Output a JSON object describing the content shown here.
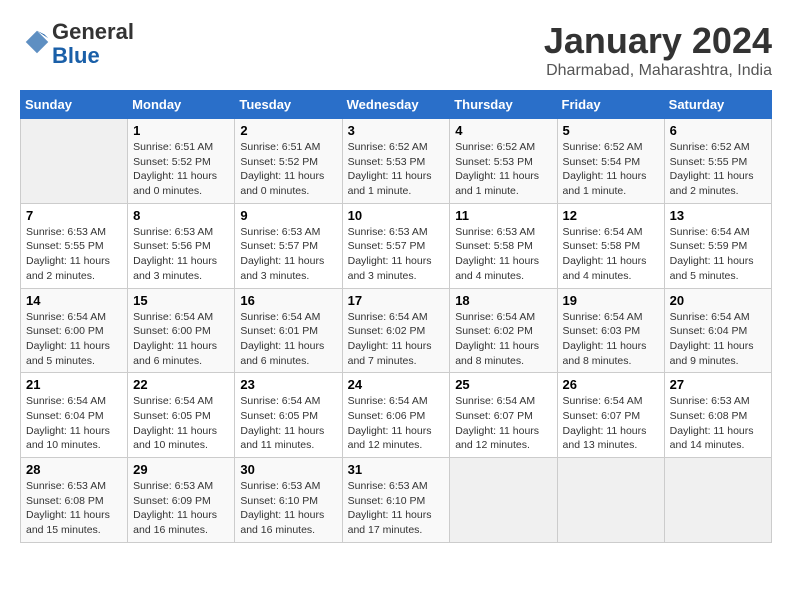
{
  "header": {
    "logo_line1": "General",
    "logo_line2": "Blue",
    "month": "January 2024",
    "location": "Dharmabad, Maharashtra, India"
  },
  "weekdays": [
    "Sunday",
    "Monday",
    "Tuesday",
    "Wednesday",
    "Thursday",
    "Friday",
    "Saturday"
  ],
  "weeks": [
    [
      {
        "day": "",
        "sunrise": "",
        "sunset": "",
        "daylight": ""
      },
      {
        "day": "1",
        "sunrise": "Sunrise: 6:51 AM",
        "sunset": "Sunset: 5:52 PM",
        "daylight": "Daylight: 11 hours and 0 minutes."
      },
      {
        "day": "2",
        "sunrise": "Sunrise: 6:51 AM",
        "sunset": "Sunset: 5:52 PM",
        "daylight": "Daylight: 11 hours and 0 minutes."
      },
      {
        "day": "3",
        "sunrise": "Sunrise: 6:52 AM",
        "sunset": "Sunset: 5:53 PM",
        "daylight": "Daylight: 11 hours and 1 minute."
      },
      {
        "day": "4",
        "sunrise": "Sunrise: 6:52 AM",
        "sunset": "Sunset: 5:53 PM",
        "daylight": "Daylight: 11 hours and 1 minute."
      },
      {
        "day": "5",
        "sunrise": "Sunrise: 6:52 AM",
        "sunset": "Sunset: 5:54 PM",
        "daylight": "Daylight: 11 hours and 1 minute."
      },
      {
        "day": "6",
        "sunrise": "Sunrise: 6:52 AM",
        "sunset": "Sunset: 5:55 PM",
        "daylight": "Daylight: 11 hours and 2 minutes."
      }
    ],
    [
      {
        "day": "7",
        "sunrise": "Sunrise: 6:53 AM",
        "sunset": "Sunset: 5:55 PM",
        "daylight": "Daylight: 11 hours and 2 minutes."
      },
      {
        "day": "8",
        "sunrise": "Sunrise: 6:53 AM",
        "sunset": "Sunset: 5:56 PM",
        "daylight": "Daylight: 11 hours and 3 minutes."
      },
      {
        "day": "9",
        "sunrise": "Sunrise: 6:53 AM",
        "sunset": "Sunset: 5:57 PM",
        "daylight": "Daylight: 11 hours and 3 minutes."
      },
      {
        "day": "10",
        "sunrise": "Sunrise: 6:53 AM",
        "sunset": "Sunset: 5:57 PM",
        "daylight": "Daylight: 11 hours and 3 minutes."
      },
      {
        "day": "11",
        "sunrise": "Sunrise: 6:53 AM",
        "sunset": "Sunset: 5:58 PM",
        "daylight": "Daylight: 11 hours and 4 minutes."
      },
      {
        "day": "12",
        "sunrise": "Sunrise: 6:54 AM",
        "sunset": "Sunset: 5:58 PM",
        "daylight": "Daylight: 11 hours and 4 minutes."
      },
      {
        "day": "13",
        "sunrise": "Sunrise: 6:54 AM",
        "sunset": "Sunset: 5:59 PM",
        "daylight": "Daylight: 11 hours and 5 minutes."
      }
    ],
    [
      {
        "day": "14",
        "sunrise": "Sunrise: 6:54 AM",
        "sunset": "Sunset: 6:00 PM",
        "daylight": "Daylight: 11 hours and 5 minutes."
      },
      {
        "day": "15",
        "sunrise": "Sunrise: 6:54 AM",
        "sunset": "Sunset: 6:00 PM",
        "daylight": "Daylight: 11 hours and 6 minutes."
      },
      {
        "day": "16",
        "sunrise": "Sunrise: 6:54 AM",
        "sunset": "Sunset: 6:01 PM",
        "daylight": "Daylight: 11 hours and 6 minutes."
      },
      {
        "day": "17",
        "sunrise": "Sunrise: 6:54 AM",
        "sunset": "Sunset: 6:02 PM",
        "daylight": "Daylight: 11 hours and 7 minutes."
      },
      {
        "day": "18",
        "sunrise": "Sunrise: 6:54 AM",
        "sunset": "Sunset: 6:02 PM",
        "daylight": "Daylight: 11 hours and 8 minutes."
      },
      {
        "day": "19",
        "sunrise": "Sunrise: 6:54 AM",
        "sunset": "Sunset: 6:03 PM",
        "daylight": "Daylight: 11 hours and 8 minutes."
      },
      {
        "day": "20",
        "sunrise": "Sunrise: 6:54 AM",
        "sunset": "Sunset: 6:04 PM",
        "daylight": "Daylight: 11 hours and 9 minutes."
      }
    ],
    [
      {
        "day": "21",
        "sunrise": "Sunrise: 6:54 AM",
        "sunset": "Sunset: 6:04 PM",
        "daylight": "Daylight: 11 hours and 10 minutes."
      },
      {
        "day": "22",
        "sunrise": "Sunrise: 6:54 AM",
        "sunset": "Sunset: 6:05 PM",
        "daylight": "Daylight: 11 hours and 10 minutes."
      },
      {
        "day": "23",
        "sunrise": "Sunrise: 6:54 AM",
        "sunset": "Sunset: 6:05 PM",
        "daylight": "Daylight: 11 hours and 11 minutes."
      },
      {
        "day": "24",
        "sunrise": "Sunrise: 6:54 AM",
        "sunset": "Sunset: 6:06 PM",
        "daylight": "Daylight: 11 hours and 12 minutes."
      },
      {
        "day": "25",
        "sunrise": "Sunrise: 6:54 AM",
        "sunset": "Sunset: 6:07 PM",
        "daylight": "Daylight: 11 hours and 12 minutes."
      },
      {
        "day": "26",
        "sunrise": "Sunrise: 6:54 AM",
        "sunset": "Sunset: 6:07 PM",
        "daylight": "Daylight: 11 hours and 13 minutes."
      },
      {
        "day": "27",
        "sunrise": "Sunrise: 6:53 AM",
        "sunset": "Sunset: 6:08 PM",
        "daylight": "Daylight: 11 hours and 14 minutes."
      }
    ],
    [
      {
        "day": "28",
        "sunrise": "Sunrise: 6:53 AM",
        "sunset": "Sunset: 6:08 PM",
        "daylight": "Daylight: 11 hours and 15 minutes."
      },
      {
        "day": "29",
        "sunrise": "Sunrise: 6:53 AM",
        "sunset": "Sunset: 6:09 PM",
        "daylight": "Daylight: 11 hours and 16 minutes."
      },
      {
        "day": "30",
        "sunrise": "Sunrise: 6:53 AM",
        "sunset": "Sunset: 6:10 PM",
        "daylight": "Daylight: 11 hours and 16 minutes."
      },
      {
        "day": "31",
        "sunrise": "Sunrise: 6:53 AM",
        "sunset": "Sunset: 6:10 PM",
        "daylight": "Daylight: 11 hours and 17 minutes."
      },
      {
        "day": "",
        "sunrise": "",
        "sunset": "",
        "daylight": ""
      },
      {
        "day": "",
        "sunrise": "",
        "sunset": "",
        "daylight": ""
      },
      {
        "day": "",
        "sunrise": "",
        "sunset": "",
        "daylight": ""
      }
    ]
  ]
}
